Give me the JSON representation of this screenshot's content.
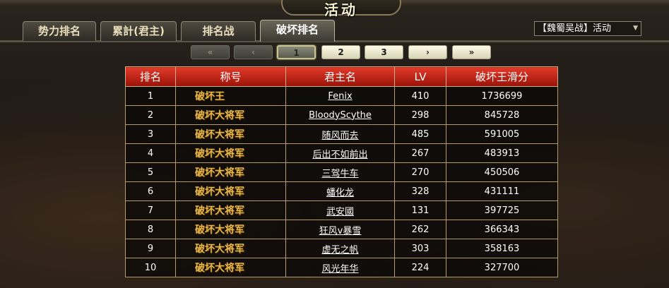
{
  "header": {
    "title": "活动"
  },
  "tabs": [
    {
      "label": "势力排名",
      "active": false
    },
    {
      "label": "累計(君主)",
      "active": false
    },
    {
      "label": "排名战",
      "active": false
    },
    {
      "label": "破坏排名",
      "active": true
    }
  ],
  "dropdown": {
    "selected": "【魏蜀吴战】活动"
  },
  "pagination": {
    "first": "«",
    "prev": "‹",
    "pages": [
      "1",
      "2",
      "3"
    ],
    "current_page": "1",
    "next": "›",
    "last": "»"
  },
  "table": {
    "headers": [
      "排名",
      "称号",
      "君主名",
      "LV",
      "破坏王滑分"
    ],
    "rows": [
      {
        "rank": "1",
        "title": "破坏王",
        "name": "Fenix",
        "lv": "410",
        "score": "1736699"
      },
      {
        "rank": "2",
        "title": "破坏大将军",
        "name": "BloodyScythe",
        "lv": "298",
        "score": "845728"
      },
      {
        "rank": "3",
        "title": "破坏大将军",
        "name": "随风而去",
        "lv": "485",
        "score": "591005"
      },
      {
        "rank": "4",
        "title": "破坏大将军",
        "name": "后出不如前出",
        "lv": "267",
        "score": "483913"
      },
      {
        "rank": "5",
        "title": "破坏大将军",
        "name": "三驾牛车",
        "lv": "270",
        "score": "450506"
      },
      {
        "rank": "6",
        "title": "破坏大将军",
        "name": "蟠化龙",
        "lv": "328",
        "score": "431111"
      },
      {
        "rank": "7",
        "title": "破坏大将军",
        "name": "武安國",
        "lv": "131",
        "score": "397725"
      },
      {
        "rank": "8",
        "title": "破坏大将军",
        "name": "狂风v暴雪",
        "lv": "262",
        "score": "366343"
      },
      {
        "rank": "9",
        "title": "破坏大将军",
        "name": "虚无之帆",
        "lv": "303",
        "score": "358163"
      },
      {
        "rank": "10",
        "title": "破坏大将军",
        "name": "风光年华",
        "lv": "224",
        "score": "327700"
      }
    ]
  },
  "colors": {
    "header_red": "#c8241a",
    "title_gold": "#e7b84a",
    "border_gold": "#b49b6a"
  }
}
